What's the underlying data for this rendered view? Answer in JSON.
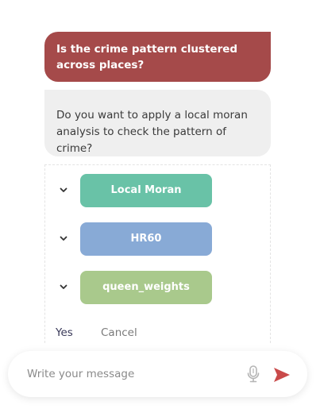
{
  "chat": {
    "user_message": "Is the crime pattern clustered across places?",
    "bot_message": "Do you want to apply a local moran analysis to check the pattern of crime?"
  },
  "options": [
    {
      "label": "Local Moran",
      "color": "#69c2a7"
    },
    {
      "label": "HR60",
      "color": "#88aad6"
    },
    {
      "label": "queen_weights",
      "color": "#a9c98c"
    }
  ],
  "actions": {
    "yes": "Yes",
    "cancel": "Cancel"
  },
  "composer": {
    "placeholder": "Write your message",
    "mic_icon": "microphone-icon",
    "send_icon": "send-icon"
  },
  "colors": {
    "user_bubble": "#a54a4a",
    "bot_bubble": "#efefef",
    "send_accent": "#c94a4a"
  }
}
